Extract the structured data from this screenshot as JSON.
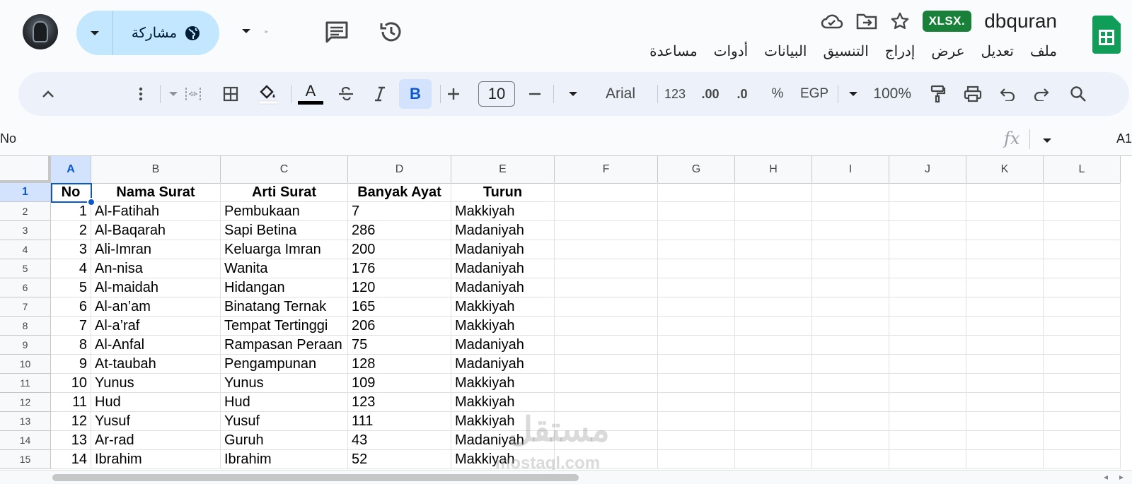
{
  "header": {
    "doc_title": "dbquran",
    "file_badge": "XLSX.",
    "share_label": "مشاركة"
  },
  "menu": [
    "ملف",
    "تعديل",
    "عرض",
    "إدراج",
    "التنسيق",
    "البيانات",
    "أدوات",
    "مساعدة"
  ],
  "toolbar": {
    "zoom": "100%",
    "currency": "EGP",
    "percent": "%",
    "decimal_dec": ".0",
    "decimal_inc": ".00",
    "number_format": "123",
    "font": "Arial",
    "font_size": "10",
    "bold": "B",
    "text_color_letter": "A"
  },
  "formula_bar": {
    "name_box": "A1",
    "content": "No",
    "fx": "fx"
  },
  "columns": [
    "A",
    "B",
    "C",
    "D",
    "E",
    "F",
    "G",
    "H",
    "I",
    "J",
    "K",
    "L"
  ],
  "rows": [
    [
      "No",
      "Nama Surat",
      "Arti Surat",
      "Banyak Ayat",
      "Turun"
    ],
    [
      "1",
      "Al-Fatihah",
      "Pembukaan",
      "7",
      "Makkiyah"
    ],
    [
      "2",
      "Al-Baqarah",
      "Sapi Betina",
      "286",
      "Madaniyah"
    ],
    [
      "3",
      "Ali-Imran",
      "Keluarga Imran",
      "200",
      "Madaniyah"
    ],
    [
      "4",
      "An-nisa",
      "Wanita",
      "176",
      "Madaniyah"
    ],
    [
      "5",
      "Al-maidah",
      "Hidangan",
      "120",
      "Madaniyah"
    ],
    [
      "6",
      "Al-an’am",
      "Binatang Ternak",
      "165",
      "Makkiyah"
    ],
    [
      "7",
      "Al-a’raf",
      "Tempat Tertinggi",
      "206",
      "Makkiyah"
    ],
    [
      "8",
      "Al-Anfal",
      "Rampasan Peraan",
      "75",
      "Madaniyah"
    ],
    [
      "9",
      "At-taubah",
      "Pengampunan",
      "128",
      "Madaniyah"
    ],
    [
      "10",
      "Yunus",
      "Yunus",
      "109",
      "Makkiyah"
    ],
    [
      "11",
      "Hud",
      "Hud",
      "123",
      "Makkiyah"
    ],
    [
      "12",
      "Yusuf",
      "Yusuf",
      "111",
      "Makkiyah"
    ],
    [
      "13",
      "Ar-rad",
      "Guruh",
      "43",
      "Madaniyah"
    ],
    [
      "14",
      "Ibrahim",
      "Ibrahim",
      "52",
      "Makkiyah"
    ]
  ],
  "watermark": {
    "arabic": "مستقل",
    "latin": "mostaql.com"
  },
  "colors": {
    "accent": "#0b57d0",
    "share_bg": "#c2e7ff",
    "toolbar_bg": "#edf2fa",
    "sheets_green": "#0f9d58",
    "badge_green": "#188038"
  }
}
